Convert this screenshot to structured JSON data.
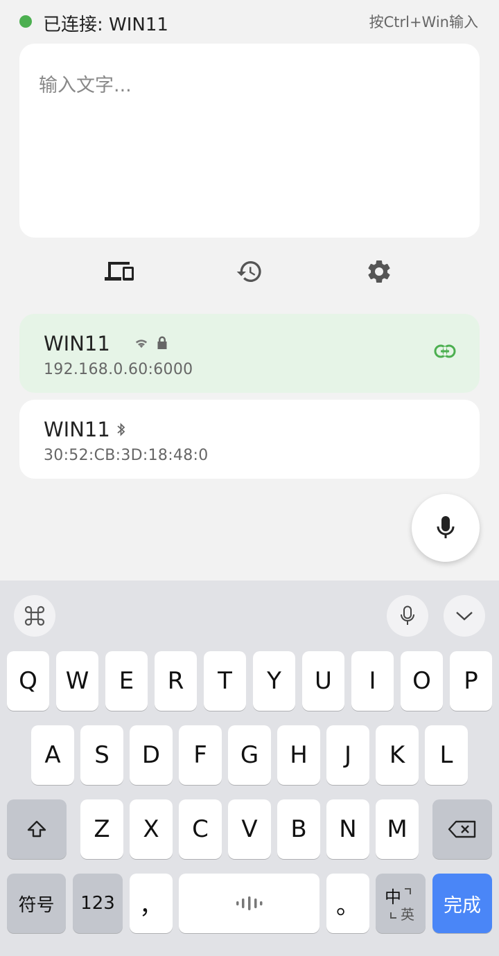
{
  "status": {
    "connection_text": "已连接: WIN11",
    "shortcut_hint": "按Ctrl+Win输入",
    "dot_color": "#4caf50"
  },
  "input": {
    "placeholder": "输入文字...",
    "value": ""
  },
  "toolbar": {
    "items": [
      {
        "icon": "devices-icon"
      },
      {
        "icon": "history-icon"
      },
      {
        "icon": "gear-icon"
      }
    ]
  },
  "devices": [
    {
      "name": "WIN11",
      "address": "192.168.0.60:6000",
      "type": "wifi",
      "secured": true,
      "connected": true
    },
    {
      "name": "WIN11",
      "address": "30:52:CB:3D:18:48:0",
      "type": "bluetooth",
      "secured": false,
      "connected": false
    }
  ],
  "colors": {
    "accent_green": "#4caf50",
    "active_card_bg": "#e6f4e7",
    "done_key": "#4a86f7"
  },
  "keyboard": {
    "row1": [
      "Q",
      "W",
      "E",
      "R",
      "T",
      "Y",
      "U",
      "I",
      "O",
      "P"
    ],
    "row2": [
      "A",
      "S",
      "D",
      "F",
      "G",
      "H",
      "J",
      "K",
      "L"
    ],
    "row3": [
      "Z",
      "X",
      "C",
      "V",
      "B",
      "N",
      "M"
    ],
    "symbols_label": "符号",
    "numbers_label": "123",
    "comma_label": "，",
    "period_label": "。",
    "lang_primary": "中",
    "lang_secondary": "英",
    "done_label": "完成"
  }
}
